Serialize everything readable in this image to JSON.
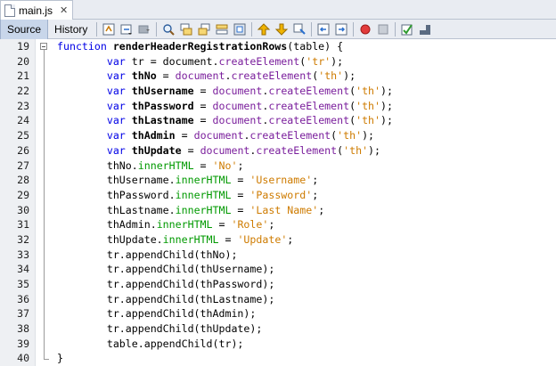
{
  "tab": {
    "filename": "main.js",
    "close": "✕"
  },
  "toolbar": {
    "source_label": "Source",
    "history_label": "History"
  },
  "editor": {
    "lines": [
      {
        "no": "19",
        "tokens": [
          [
            "kw",
            "function "
          ],
          [
            "fn",
            "renderHeaderRegistrationRows"
          ],
          [
            "",
            "(table) {"
          ]
        ]
      },
      {
        "no": "20",
        "tokens": [
          [
            "",
            "        "
          ],
          [
            "kw",
            "var "
          ],
          [
            "",
            "tr = document."
          ],
          [
            "meth",
            "createElement"
          ],
          [
            "",
            "("
          ],
          [
            "str",
            "'tr'"
          ],
          [
            "",
            ");"
          ]
        ]
      },
      {
        "no": "21",
        "tokens": [
          [
            "",
            "        "
          ],
          [
            "kw",
            "var "
          ],
          [
            "decl",
            "thNo"
          ],
          [
            "",
            " = "
          ],
          [
            "meth",
            "document"
          ],
          [
            "",
            "."
          ],
          [
            "meth",
            "createElement"
          ],
          [
            "",
            "("
          ],
          [
            "str",
            "'th'"
          ],
          [
            "",
            ");"
          ]
        ]
      },
      {
        "no": "22",
        "tokens": [
          [
            "",
            "        "
          ],
          [
            "kw",
            "var "
          ],
          [
            "decl",
            "thUsername"
          ],
          [
            "",
            " = "
          ],
          [
            "meth",
            "document"
          ],
          [
            "",
            "."
          ],
          [
            "meth",
            "createElement"
          ],
          [
            "",
            "("
          ],
          [
            "str",
            "'th'"
          ],
          [
            "",
            ");"
          ]
        ]
      },
      {
        "no": "23",
        "tokens": [
          [
            "",
            "        "
          ],
          [
            "kw",
            "var "
          ],
          [
            "decl",
            "thPassword"
          ],
          [
            "",
            " = "
          ],
          [
            "meth",
            "document"
          ],
          [
            "",
            "."
          ],
          [
            "meth",
            "createElement"
          ],
          [
            "",
            "("
          ],
          [
            "str",
            "'th'"
          ],
          [
            "",
            ");"
          ]
        ]
      },
      {
        "no": "24",
        "tokens": [
          [
            "",
            "        "
          ],
          [
            "kw",
            "var "
          ],
          [
            "decl",
            "thLastname"
          ],
          [
            "",
            " = "
          ],
          [
            "meth",
            "document"
          ],
          [
            "",
            "."
          ],
          [
            "meth",
            "createElement"
          ],
          [
            "",
            "("
          ],
          [
            "str",
            "'th'"
          ],
          [
            "",
            ");"
          ]
        ]
      },
      {
        "no": "25",
        "tokens": [
          [
            "",
            "        "
          ],
          [
            "kw",
            "var "
          ],
          [
            "decl",
            "thAdmin"
          ],
          [
            "",
            " = "
          ],
          [
            "meth",
            "document"
          ],
          [
            "",
            "."
          ],
          [
            "meth",
            "createElement"
          ],
          [
            "",
            "("
          ],
          [
            "str",
            "'th'"
          ],
          [
            "",
            ");"
          ]
        ]
      },
      {
        "no": "26",
        "tokens": [
          [
            "",
            "        "
          ],
          [
            "kw",
            "var "
          ],
          [
            "decl",
            "thUpdate"
          ],
          [
            "",
            " = "
          ],
          [
            "meth",
            "document"
          ],
          [
            "",
            "."
          ],
          [
            "meth",
            "createElement"
          ],
          [
            "",
            "("
          ],
          [
            "str",
            "'th'"
          ],
          [
            "",
            ");"
          ]
        ]
      },
      {
        "no": "27",
        "tokens": [
          [
            "",
            "        thNo."
          ],
          [
            "prop",
            "innerHTML"
          ],
          [
            "",
            " = "
          ],
          [
            "str",
            "'No'"
          ],
          [
            "",
            ";"
          ]
        ]
      },
      {
        "no": "28",
        "tokens": [
          [
            "",
            "        thUsername."
          ],
          [
            "prop",
            "innerHTML"
          ],
          [
            "",
            " = "
          ],
          [
            "str",
            "'Username'"
          ],
          [
            "",
            ";"
          ]
        ]
      },
      {
        "no": "29",
        "tokens": [
          [
            "",
            "        thPassword."
          ],
          [
            "prop",
            "innerHTML"
          ],
          [
            "",
            " = "
          ],
          [
            "str",
            "'Password'"
          ],
          [
            "",
            ";"
          ]
        ]
      },
      {
        "no": "30",
        "tokens": [
          [
            "",
            "        thLastname."
          ],
          [
            "prop",
            "innerHTML"
          ],
          [
            "",
            " = "
          ],
          [
            "str",
            "'Last Name'"
          ],
          [
            "",
            ";"
          ]
        ]
      },
      {
        "no": "31",
        "tokens": [
          [
            "",
            "        thAdmin."
          ],
          [
            "prop",
            "innerHTML"
          ],
          [
            "",
            " = "
          ],
          [
            "str",
            "'Role'"
          ],
          [
            "",
            ";"
          ]
        ]
      },
      {
        "no": "32",
        "tokens": [
          [
            "",
            "        thUpdate."
          ],
          [
            "prop",
            "innerHTML"
          ],
          [
            "",
            " = "
          ],
          [
            "str",
            "'Update'"
          ],
          [
            "",
            ";"
          ]
        ]
      },
      {
        "no": "33",
        "tokens": [
          [
            "",
            "        tr.appendChild(thNo);"
          ]
        ]
      },
      {
        "no": "34",
        "tokens": [
          [
            "",
            "        tr.appendChild(thUsername);"
          ]
        ]
      },
      {
        "no": "35",
        "tokens": [
          [
            "",
            "        tr.appendChild(thPassword);"
          ]
        ]
      },
      {
        "no": "36",
        "tokens": [
          [
            "",
            "        tr.appendChild(thLastname);"
          ]
        ]
      },
      {
        "no": "37",
        "tokens": [
          [
            "",
            "        tr.appendChild(thAdmin);"
          ]
        ]
      },
      {
        "no": "38",
        "tokens": [
          [
            "",
            "        tr.appendChild(thUpdate);"
          ]
        ]
      },
      {
        "no": "39",
        "tokens": [
          [
            "",
            "        table.appendChild(tr);"
          ]
        ]
      },
      {
        "no": "40",
        "tokens": [
          [
            "",
            "}"
          ]
        ]
      }
    ]
  },
  "colors": {
    "keyword": "#0000e6",
    "string": "#ce7b00",
    "property": "#009900",
    "method": "#7a1e9c"
  }
}
